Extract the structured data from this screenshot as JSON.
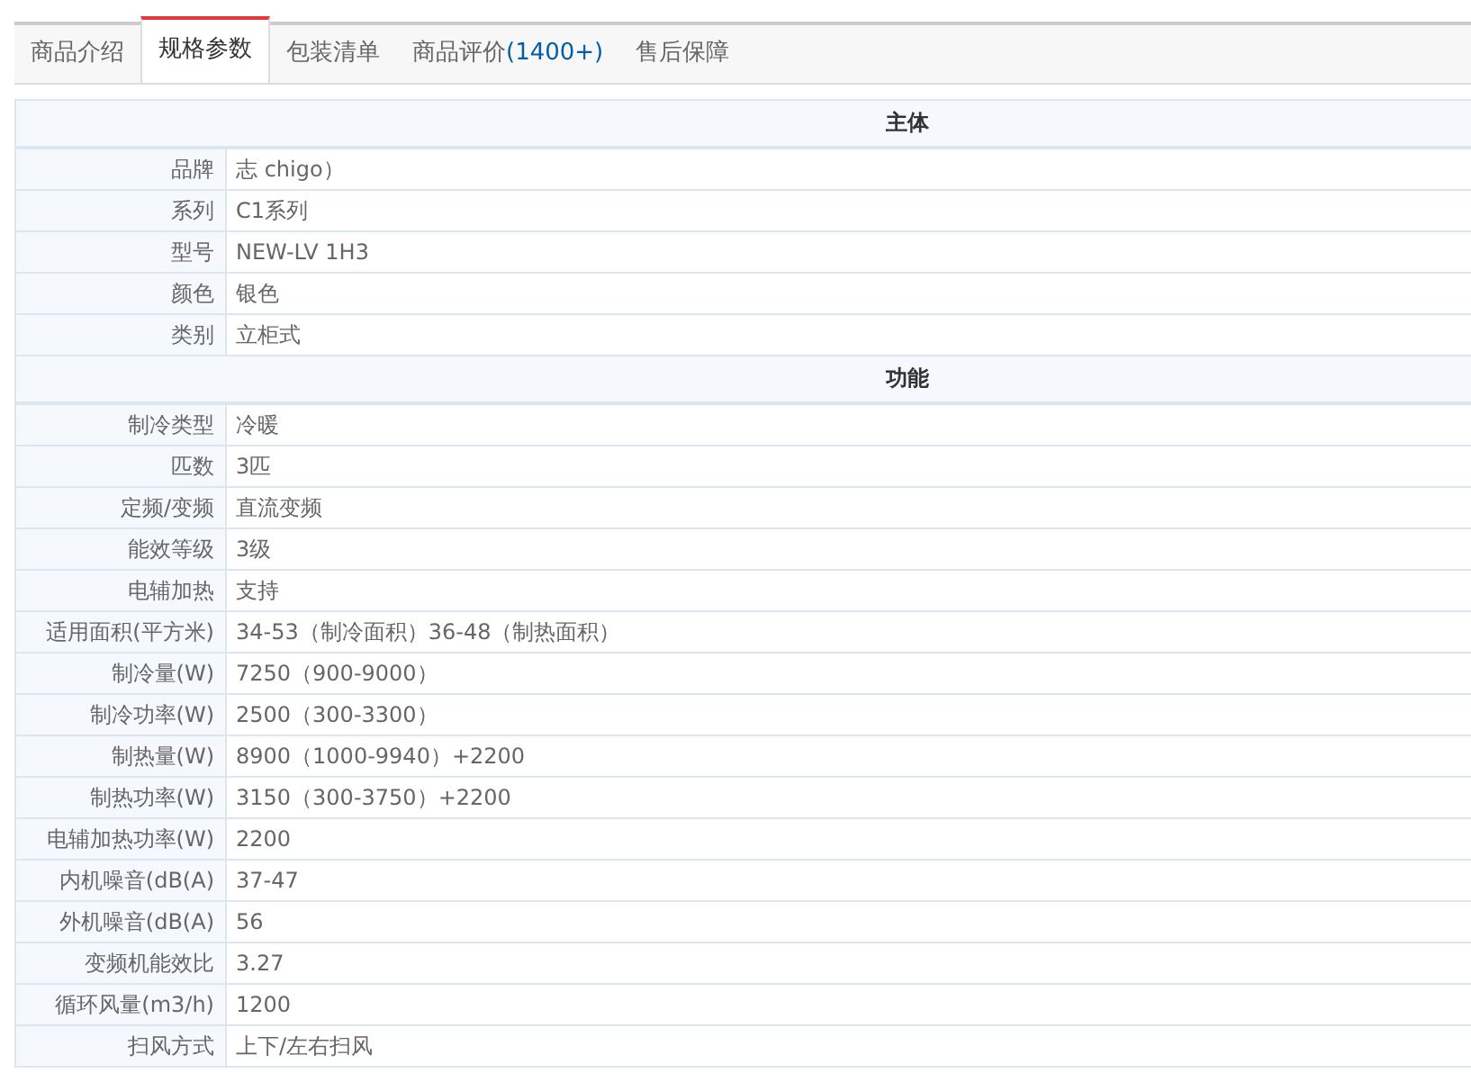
{
  "tabs": [
    {
      "label": "商品介绍",
      "selected": false
    },
    {
      "label": "规格参数",
      "selected": true
    },
    {
      "label": "包装清单",
      "selected": false
    },
    {
      "label": "商品评价",
      "count": "(1400+)",
      "selected": false
    },
    {
      "label": "售后保障",
      "selected": false
    }
  ],
  "sections": [
    {
      "title": "主体",
      "rows": [
        {
          "label": "品牌",
          "value": "志 chigo）"
        },
        {
          "label": "系列",
          "value": "C1系列"
        },
        {
          "label": "型号",
          "value": "NEW-LV 1H3"
        },
        {
          "label": "颜色",
          "value": "银色"
        },
        {
          "label": "类别",
          "value": "立柜式"
        }
      ]
    },
    {
      "title": "功能",
      "rows": [
        {
          "label": "制冷类型",
          "value": "冷暖"
        },
        {
          "label": "匹数",
          "value": "3匹"
        },
        {
          "label": "定频/变频",
          "value": "直流变频"
        },
        {
          "label": "能效等级",
          "value": "3级"
        },
        {
          "label": "电辅加热",
          "value": "支持"
        },
        {
          "label": "适用面积(平方米)",
          "value": "34-53（制冷面积）36-48（制热面积）"
        },
        {
          "label": "制冷量(W)",
          "value": "7250（900-9000）"
        },
        {
          "label": "制冷功率(W)",
          "value": "2500（300-3300）"
        },
        {
          "label": "制热量(W)",
          "value": "8900（1000-9940）+2200"
        },
        {
          "label": "制热功率(W)",
          "value": "3150（300-3750）+2200"
        },
        {
          "label": "电辅加热功率(W)",
          "value": "2200"
        },
        {
          "label": "内机噪音(dB(A)",
          "value": "37-47"
        },
        {
          "label": "外机噪音(dB(A)",
          "value": "56"
        },
        {
          "label": "变频机能效比",
          "value": "3.27"
        },
        {
          "label": "循环风量(m3/h)",
          "value": "1200"
        },
        {
          "label": "扫风方式",
          "value": "上下/左右扫风"
        }
      ]
    }
  ]
}
